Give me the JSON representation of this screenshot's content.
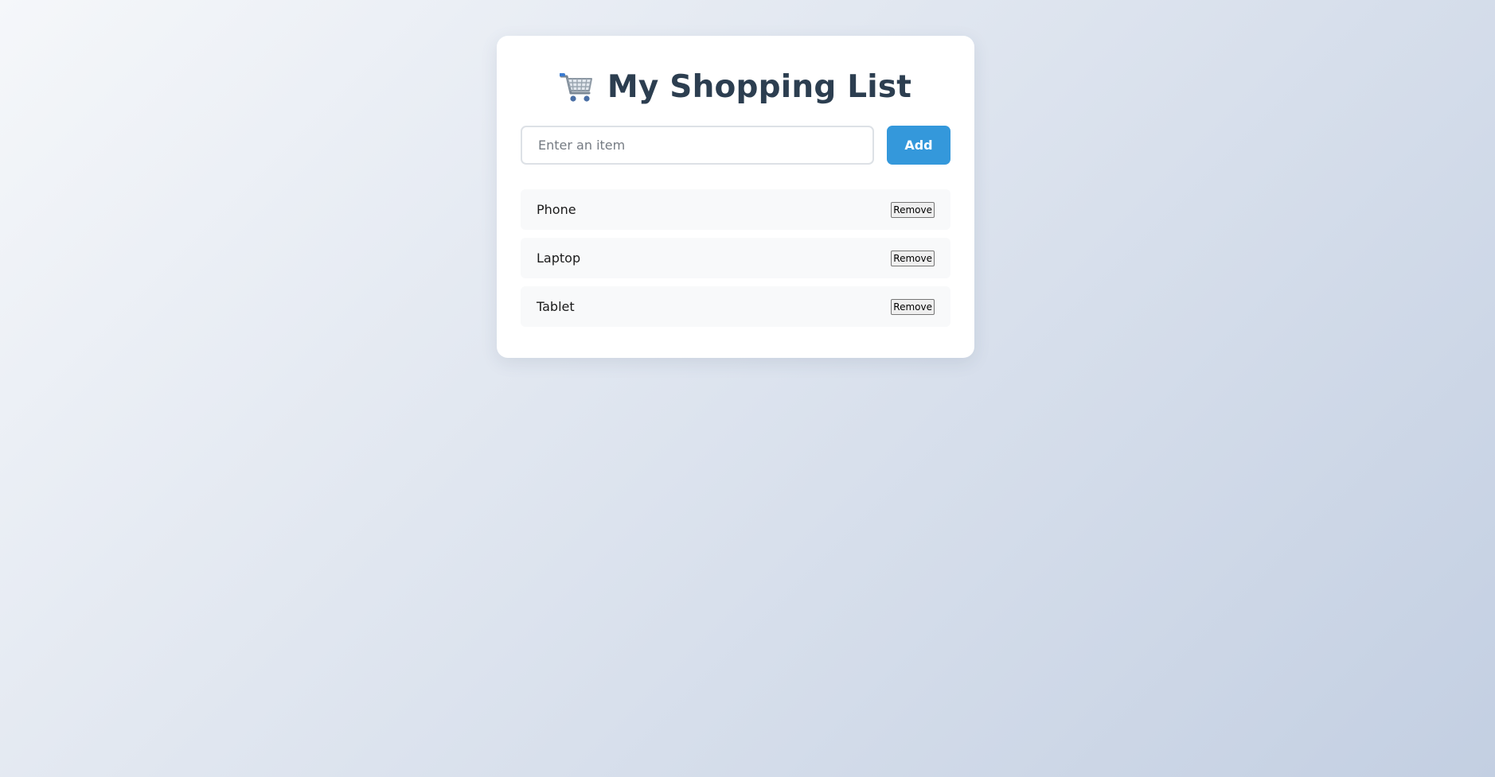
{
  "header": {
    "title": "My Shopping List",
    "icon": "shopping-cart-icon"
  },
  "add_form": {
    "input_placeholder": "Enter an item",
    "input_value": "",
    "add_label": "Add"
  },
  "items": [
    {
      "name": "Phone",
      "remove_label": "Remove"
    },
    {
      "name": "Laptop",
      "remove_label": "Remove"
    },
    {
      "name": "Tablet",
      "remove_label": "Remove"
    }
  ],
  "colors": {
    "accent": "#3498db",
    "title": "#2c3e50",
    "item_background": "#f8f9fa",
    "background_start": "#f5f7fa",
    "background_end": "#c3cfe2"
  }
}
